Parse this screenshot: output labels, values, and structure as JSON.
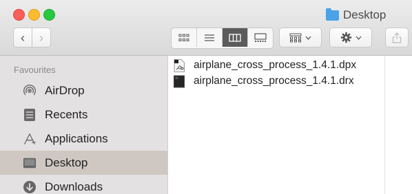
{
  "window": {
    "title": "Desktop"
  },
  "toolbar": {
    "back_label": "‹",
    "forward_label": "›"
  },
  "sidebar": {
    "heading": "Favourites",
    "items": [
      {
        "label": "AirDrop",
        "icon": "airdrop-icon"
      },
      {
        "label": "Recents",
        "icon": "recents-icon"
      },
      {
        "label": "Applications",
        "icon": "applications-icon"
      },
      {
        "label": "Desktop",
        "icon": "desktop-icon",
        "selected": true
      },
      {
        "label": "Downloads",
        "icon": "downloads-icon"
      }
    ]
  },
  "files": [
    {
      "name": "airplane_cross_process_1.4.1.dpx",
      "icon": "dpx-file-icon"
    },
    {
      "name": "airplane_cross_process_1.4.1.drx",
      "icon": "drx-file-icon"
    }
  ],
  "colors": {
    "close": "#fc5f57",
    "minimize": "#fdbc2e",
    "maximize": "#28c840",
    "folder_accent": "#4aa3e8",
    "sidebar_selection": "#cfc8c2"
  }
}
